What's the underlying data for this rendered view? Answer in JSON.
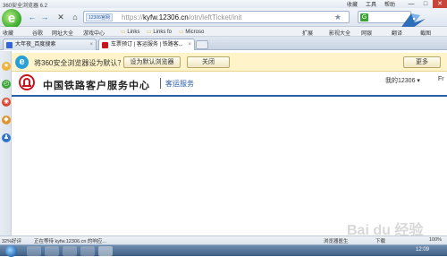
{
  "window": {
    "title": "360安全浏览器 6.2",
    "menu": [
      "收藏",
      "工具",
      "帮助"
    ],
    "controls": [
      "—",
      "□",
      "✕"
    ]
  },
  "nav": {
    "back": "←",
    "forward": "→",
    "close": "✕",
    "home": "⌂",
    "badge": "12306官网",
    "url_prefix": "https://",
    "url_domain": "kyfw.12306.cn",
    "url_path": "/otn/leftTicket/init",
    "star": "★",
    "search_icon": "G"
  },
  "favorites": {
    "items": [
      "收藏",
      "谷歌",
      "网址大全",
      "游戏中心",
      "Links",
      "Links fo",
      "Microso",
      "扩展",
      "网银",
      "翻译",
      "截图"
    ],
    "right": [
      "影视大全"
    ]
  },
  "tabs": [
    {
      "label": "大年夜_百度搜索",
      "active": false
    },
    {
      "label": "车票预订 | 客运服务 | 铁路客...",
      "active": true
    }
  ],
  "notification": {
    "message": "将360安全浏览器设为默认？",
    "set_default": "设为默认浏览器",
    "close": "关闭",
    "more": "更多"
  },
  "site": {
    "name": "中国铁路客户服务中心",
    "sub": "客运服务",
    "account": "我的12306 ▾",
    "lang": "Fr"
  },
  "statusbar": {
    "left": "32%好评",
    "loading": "正在等待 kyfw.12306.cn 的响应...",
    "accel": "浏览器医生",
    "download": "下载",
    "zoom": "100%"
  },
  "watermark": "Bai du 经验",
  "taskbar": {
    "time": "12:09"
  },
  "colors": {
    "accent": "#2a5fa6",
    "brand_red": "#c8151d",
    "notif_bg": "#fff4c9"
  }
}
